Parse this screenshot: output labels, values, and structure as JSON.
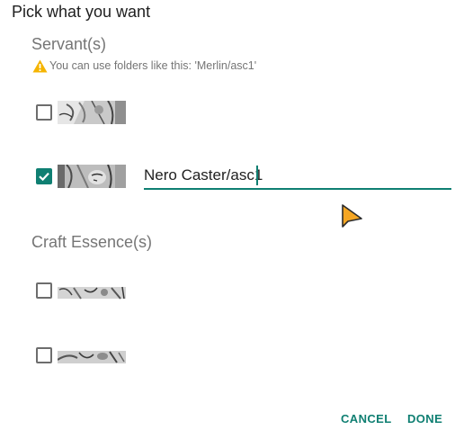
{
  "dialog": {
    "title": "Pick what you want"
  },
  "servants": {
    "section_title": "Servant(s)",
    "hint": "You can use folders like this: 'Merlin/asc1'",
    "hint_icon": "warning-icon",
    "items": [
      {
        "checked": false
      },
      {
        "checked": true,
        "folder_value": "Nero Caster/asc1"
      }
    ]
  },
  "craft_essences": {
    "section_title": "Craft Essence(s)",
    "items": [
      {
        "checked": false
      },
      {
        "checked": false
      }
    ]
  },
  "actions": {
    "cancel_label": "CANCEL",
    "done_label": "DONE"
  },
  "colors": {
    "accent": "#0f7f72",
    "warning": "#f5b400",
    "cursor": "#f5a623"
  }
}
